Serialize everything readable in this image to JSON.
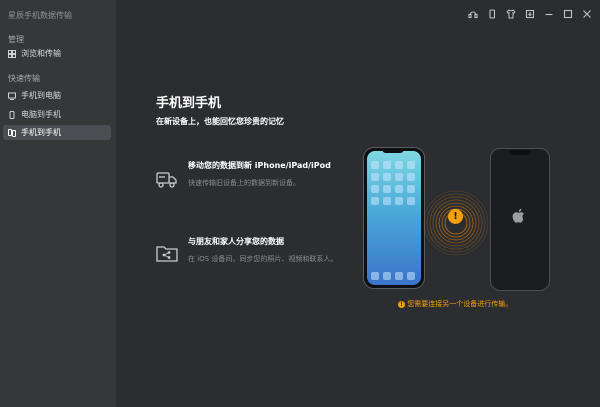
{
  "app": {
    "title": "星辰手机数据传输"
  },
  "sidebar": {
    "sections": [
      {
        "label": "管理"
      },
      {
        "label": "快速传输"
      }
    ],
    "items": [
      {
        "label": "浏览和传输",
        "icon": "grid-icon"
      },
      {
        "label": "手机到电脑",
        "icon": "phone-to-pc-icon"
      },
      {
        "label": "电脑到手机",
        "icon": "pc-to-phone-icon"
      },
      {
        "label": "手机到手机",
        "icon": "phone-to-phone-icon",
        "active": true
      }
    ]
  },
  "titlebar": {
    "icons": [
      "support-icon",
      "phone-icon",
      "shirt-icon",
      "download-icon",
      "minimize-icon",
      "maximize-icon",
      "close-icon"
    ]
  },
  "main": {
    "title": "手机到手机",
    "subtitle": "在新设备上，也能回忆您珍贵的记忆",
    "features": [
      {
        "title": "移动您的数据到新 iPhone/iPad/iPod",
        "desc": "快速传输旧设备上的数据到新设备。",
        "icon": "truck-icon"
      },
      {
        "title": "与朋友和家人分享您的数据",
        "desc": "在 iOS 设备间，同步您的照片、视频和联系人。",
        "icon": "share-folder-icon"
      }
    ],
    "hint": "您需要连接另一个设备进行传输。",
    "warn_symbol": "!"
  },
  "colors": {
    "accent": "#f3a10a",
    "sidebar_bg": "#353739",
    "main_bg": "#2b2d31"
  }
}
